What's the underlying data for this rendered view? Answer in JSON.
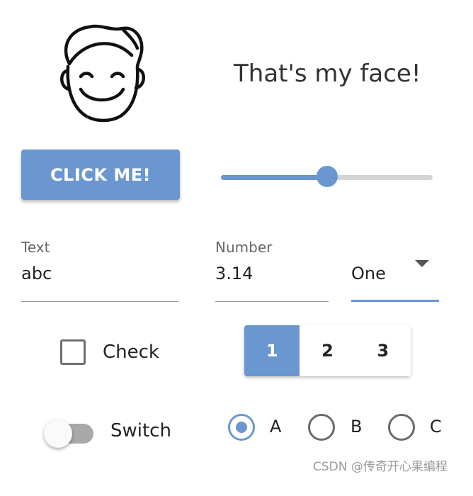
{
  "header": {
    "title": "That's my face!",
    "face_icon": "smiling-face-icon"
  },
  "button": {
    "label": "CLICK ME!"
  },
  "slider": {
    "value": 0.5
  },
  "fields": {
    "text": {
      "label": "Text",
      "value": "abc"
    },
    "number": {
      "label": "Number",
      "value": "3.14"
    },
    "select": {
      "value": "One"
    }
  },
  "checkbox": {
    "label": "Check",
    "checked": false
  },
  "segmented": {
    "options": [
      "1",
      "2",
      "3"
    ],
    "selected": "1"
  },
  "switch": {
    "label": "Switch",
    "on": false
  },
  "radios": {
    "options": [
      "A",
      "B",
      "C"
    ],
    "selected": "A"
  },
  "watermark": "CSDN @传奇开心果编程",
  "colors": {
    "accent": "#6a97d0",
    "track": "#d4d4d4",
    "switch_off": "#a9a9a9"
  }
}
